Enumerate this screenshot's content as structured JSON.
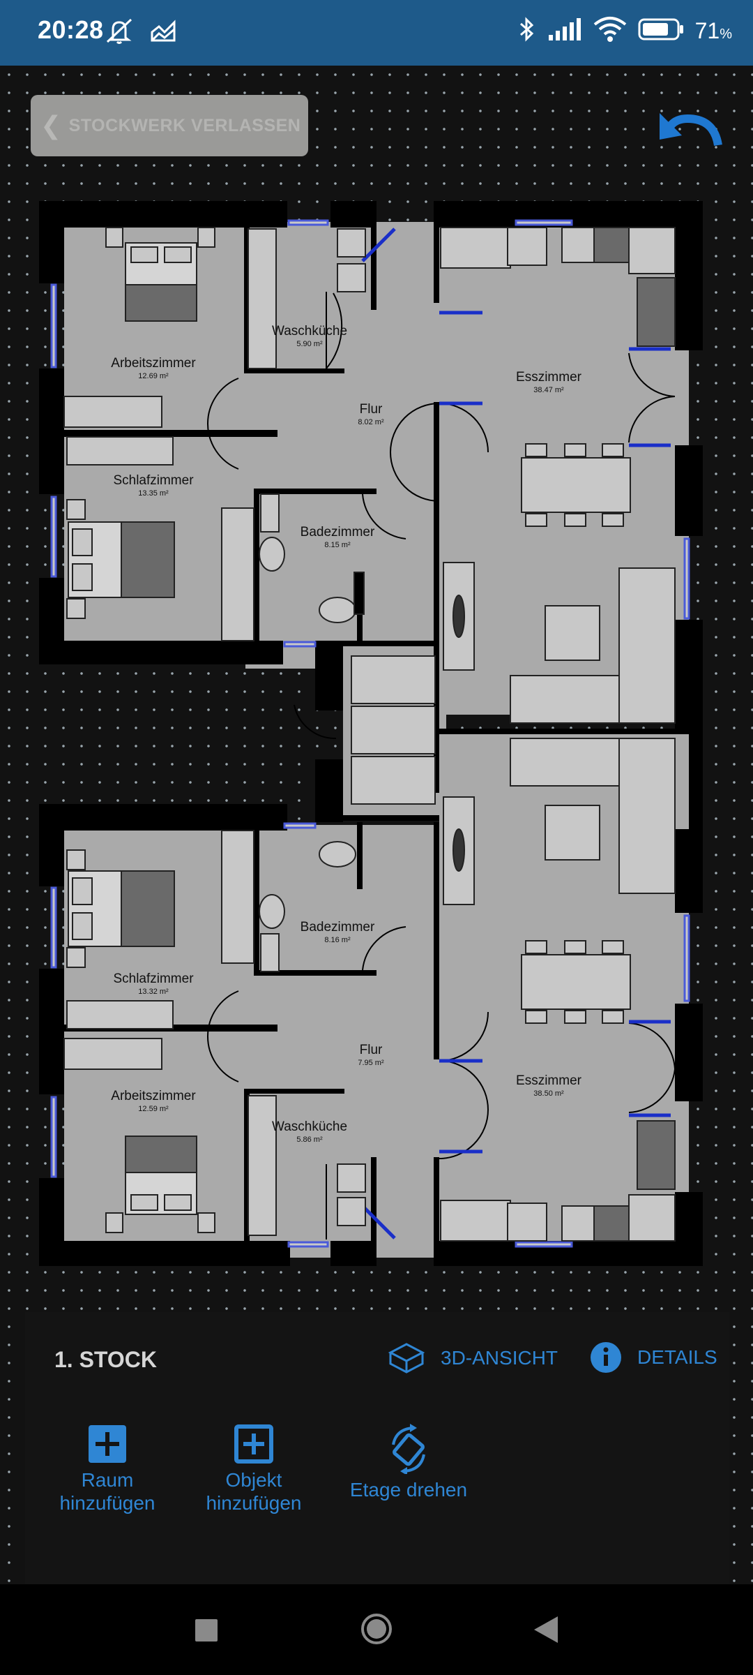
{
  "status_bar": {
    "time": "20:28",
    "battery_percent": "71",
    "battery_unit": "%",
    "icons": [
      "mute-icon",
      "sync-icon",
      "bluetooth-icon",
      "signal-icon",
      "wifi-icon",
      "battery-icon"
    ]
  },
  "toolbar": {
    "leave_label": "STOCKWERK VERLASSEN",
    "undo_icon": "undo-icon"
  },
  "floorplan": {
    "rooms": [
      {
        "name": "Arbeitszimmer",
        "area": "12.69 m²"
      },
      {
        "name": "Waschküche",
        "area": "5.90 m²"
      },
      {
        "name": "Flur",
        "area": "8.02 m²"
      },
      {
        "name": "Schlafzimmer",
        "area": "13.35 m²"
      },
      {
        "name": "Badezimmer",
        "area": "8.15 m²"
      },
      {
        "name": "Esszimmer",
        "area": "38.47 m²"
      },
      {
        "name": "Schlafzimmer",
        "area": "13.32 m²"
      },
      {
        "name": "Badezimmer",
        "area": "8.16 m²"
      },
      {
        "name": "Flur",
        "area": "7.95 m²"
      },
      {
        "name": "Arbeitszimmer",
        "area": "12.59 m²"
      },
      {
        "name": "Waschküche",
        "area": "5.86 m²"
      },
      {
        "name": "Esszimmer",
        "area": "38.50 m²"
      }
    ]
  },
  "panel": {
    "floor_name": "1. STOCK",
    "view_3d_label": "3D-ANSICHT",
    "details_label": "DETAILS",
    "actions": [
      {
        "line1": "Raum",
        "line2": "hinzufügen",
        "icon": "plus-box-icon"
      },
      {
        "line1": "Objekt",
        "line2": "hinzufügen",
        "icon": "plus-box-outline-icon"
      },
      {
        "line1": "Etage drehen",
        "line2": "",
        "icon": "rotate-icon"
      }
    ]
  },
  "colors": {
    "accent": "#2f86d4",
    "status_bar": "#1e5a8a",
    "room_fill": "#aaaaaa",
    "wall": "#000000",
    "door_blue": "#1a2fc8"
  }
}
